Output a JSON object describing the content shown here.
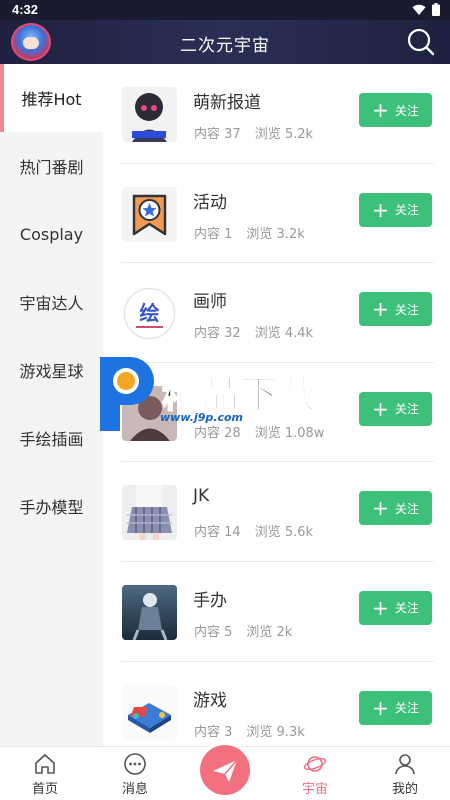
{
  "status_bar": {
    "time": "4:32"
  },
  "header": {
    "title": "二次元宇宙"
  },
  "sidebar": {
    "items": [
      {
        "label": "推荐Hot",
        "active": true
      },
      {
        "label": "热门番剧",
        "active": false
      },
      {
        "label": "Cosplay",
        "active": false
      },
      {
        "label": "宇宙达人",
        "active": false
      },
      {
        "label": "游戏星球",
        "active": false
      },
      {
        "label": "手绘插画",
        "active": false
      },
      {
        "label": "手办模型",
        "active": false
      }
    ]
  },
  "list": {
    "follow_label": "关注",
    "rows": [
      {
        "title": "萌新报道",
        "stats": "内容 37",
        "views": "浏览 5.2k",
        "icon": "anime-girl-thumbnail"
      },
      {
        "title": "活动",
        "stats": "内容 1",
        "views": "浏览 3.2k",
        "icon": "star-bookmark-icon"
      },
      {
        "title": "画师",
        "stats": "内容 32",
        "views": "浏览 4.4k",
        "icon": "painter-badge-icon"
      },
      {
        "title": "",
        "stats": "内容 28",
        "views": "浏览 1.08w",
        "icon": "character-thumbnail"
      },
      {
        "title": "JK",
        "stats": "内容 14",
        "views": "浏览 5.6k",
        "icon": "jk-uniform-thumbnail"
      },
      {
        "title": "手办",
        "stats": "内容 5",
        "views": "浏览 2k",
        "icon": "figure-thumbnail"
      },
      {
        "title": "游戏",
        "stats": "内容 3",
        "views": "浏览 9.3k",
        "icon": "game-console-icon"
      }
    ]
  },
  "watermark": {
    "text": "精品下载",
    "url": "www.j9p.com"
  },
  "bottom_nav": {
    "items": [
      {
        "label": "首页",
        "icon": "home-icon"
      },
      {
        "label": "消息",
        "icon": "message-icon"
      },
      {
        "label": "",
        "icon": "send-icon"
      },
      {
        "label": "宇宙",
        "icon": "planet-icon",
        "active": true
      },
      {
        "label": "我的",
        "icon": "user-icon"
      }
    ]
  },
  "colors": {
    "accent_green": "#3cc07a",
    "accent_pink": "#f06e86",
    "header_bg": "#202040"
  }
}
